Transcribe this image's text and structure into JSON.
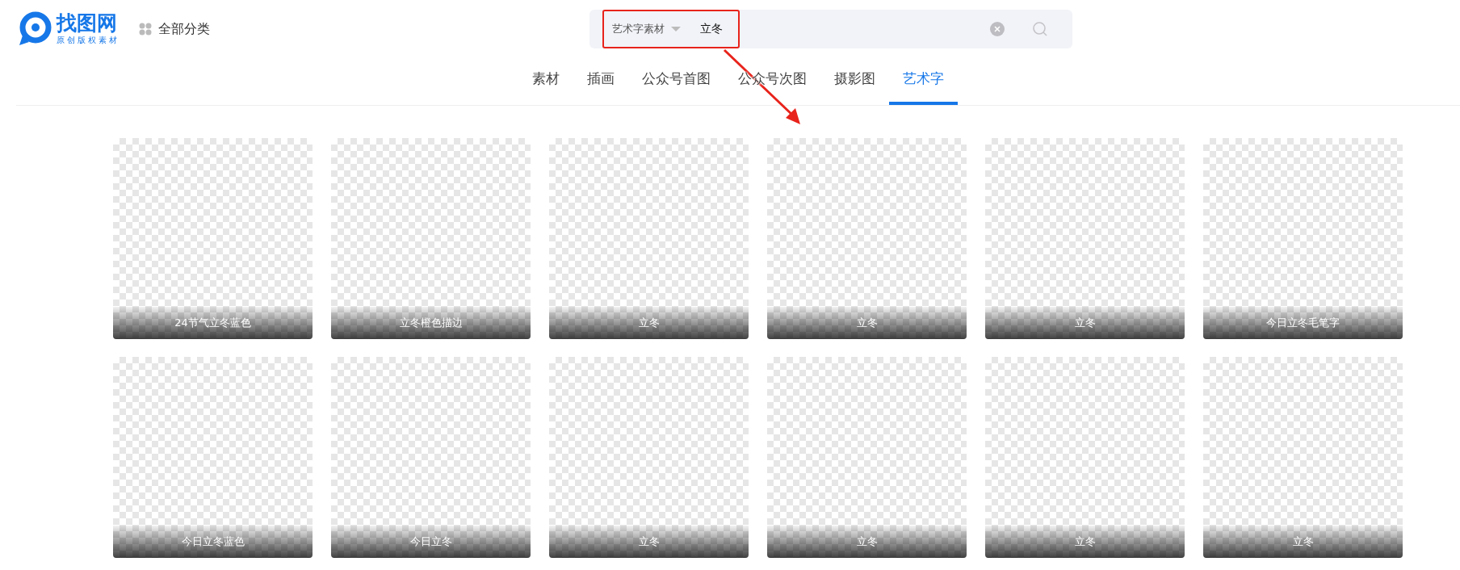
{
  "logo": {
    "name": "找图网",
    "tagline": "原创版权素材"
  },
  "category_menu": {
    "label": "全部分类"
  },
  "search": {
    "scope": "艺术字素材",
    "value": "立冬"
  },
  "tabs": [
    {
      "label": "素材",
      "selected": false
    },
    {
      "label": "插画",
      "selected": false
    },
    {
      "label": "公众号首图",
      "selected": false
    },
    {
      "label": "公众号次图",
      "selected": false
    },
    {
      "label": "摄影图",
      "selected": false
    },
    {
      "label": "艺术字",
      "selected": true
    }
  ],
  "results": [
    {
      "caption": "24节气立冬蓝色"
    },
    {
      "caption": "立冬橙色描边"
    },
    {
      "caption": "立冬"
    },
    {
      "caption": "立冬"
    },
    {
      "caption": "立冬"
    },
    {
      "caption": "今日立冬毛笔字"
    },
    {
      "caption": "今日立冬蓝色"
    },
    {
      "caption": "今日立冬"
    },
    {
      "caption": "立冬"
    },
    {
      "caption": "立冬"
    },
    {
      "caption": "立冬"
    },
    {
      "caption": "立冬"
    }
  ]
}
